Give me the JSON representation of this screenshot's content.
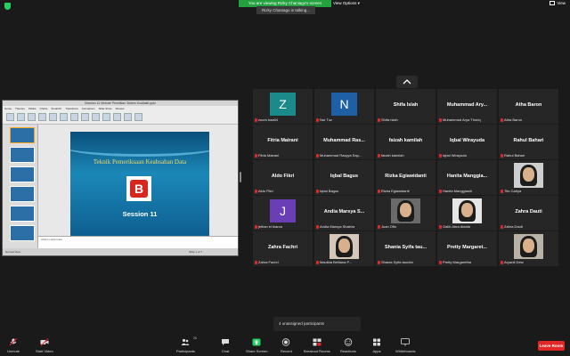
{
  "banner": {
    "text": "You are viewing Rizky Chaniago's screen"
  },
  "speaker_tag": "Rizky Chaniago is talking...",
  "view_options": "View Options ▾",
  "view_button": "View",
  "shared_screen": {
    "window_title": "Session 11 Metode Penelitian Sistem Kualitatif.pptx",
    "ribbon_tabs": [
      "Home",
      "Themes",
      "Tables",
      "Charts",
      "SmartArt",
      "Transitions",
      "Animations",
      "Slide Show",
      "Review"
    ],
    "slide_title": "Teknik Pemeriksaan Keabsahan Data",
    "slide_subtitle": "Session 11",
    "logo_letter": "B",
    "notes_placeholder": "Click to add notes",
    "status_left": "Normal View",
    "status_right": "Slide 1 of 7"
  },
  "participants": [
    {
      "display": "Z",
      "avatar_color": "#1a8a8a",
      "label": "zoom baa04",
      "muted": true
    },
    {
      "display": "N",
      "avatar_color": "#1f5fa6",
      "label": "Nur Tuz",
      "muted": true
    },
    {
      "display_name": "Shifa Islah",
      "label": "Shifa Islah",
      "muted": true
    },
    {
      "display_name": "Muhammad Ary...",
      "label": "Muhammad Arya Thoriq",
      "muted": true
    },
    {
      "display_name": "Atha Baron",
      "label": "Atha Baron",
      "muted": true
    },
    {
      "display_name": "Fitria Mairani",
      "label": "Fitria Mairani",
      "muted": true
    },
    {
      "display_name": "Muhammad Ras...",
      "label": "Muhammad Rasyya Sap...",
      "muted": true
    },
    {
      "display_name": "faizah kamilah",
      "label": "faizah kamilah",
      "muted": true
    },
    {
      "display_name": "Iqbal Wirayuda",
      "label": "Iqbal Wirayuda",
      "muted": true
    },
    {
      "display_name": "Rahul Bahari",
      "label": "Rahul Bahari",
      "muted": true
    },
    {
      "display_name": "Aldo Fikri",
      "label": "Aldo Fikri",
      "muted": true
    },
    {
      "display_name": "Iqbal Bagus",
      "label": "Iqbal Bagus",
      "muted": true
    },
    {
      "display_name": "Rizka Egiawidanti",
      "label": "Rizka Egiawidanti",
      "muted": true
    },
    {
      "display_name": "Hanita Manggia...",
      "label": "Hanita Manggiasih",
      "muted": true
    },
    {
      "photo": true,
      "label": "Tito Cahya",
      "muted": true
    },
    {
      "display": "J",
      "avatar_color": "#6a3fb5",
      "label": "jeihan el biarca",
      "muted": true
    },
    {
      "display_name": "Andia Marsya S...",
      "label": "Andia Marsya Shabira",
      "muted": true
    },
    {
      "photo": true,
      "label": "Juan Ofin",
      "muted": true
    },
    {
      "photo": true,
      "label": "Galih Abra Aldafa",
      "muted": true
    },
    {
      "display_name": "Zahra Dauti",
      "label": "Zahra Dauti",
      "muted": true
    },
    {
      "display_name": "Zahra Fachri",
      "label": "Zahra Fachri",
      "muted": true
    },
    {
      "photo": true,
      "label": "Maulida Belliana P...",
      "muted": true
    },
    {
      "display_name": "Shania Syifa tau...",
      "label": "Shania Syifa tauchid",
      "muted": true
    },
    {
      "display_name": "Pretty Margaret...",
      "label": "Pretty Margaretha",
      "muted": true
    },
    {
      "photo": true,
      "label": "Aryanti Dewi",
      "muted": true
    }
  ],
  "unassigned": "4 unassigned participants",
  "toolbar": {
    "unmute": "Unmute",
    "start_video": "Start Video",
    "participants": "Participants",
    "participants_count": "26",
    "chat": "Chat",
    "share_screen": "Share Screen",
    "record": "Record",
    "breakout_rooms": "Breakout Rooms",
    "reactions": "Reactions",
    "apps": "Apps",
    "whiteboards": "Whiteboards",
    "leave": "Leave Room"
  },
  "colors": {
    "muted_mic": "#e02828",
    "banner": "#23a23f",
    "share": "#23d160",
    "leave": "#e02828"
  }
}
